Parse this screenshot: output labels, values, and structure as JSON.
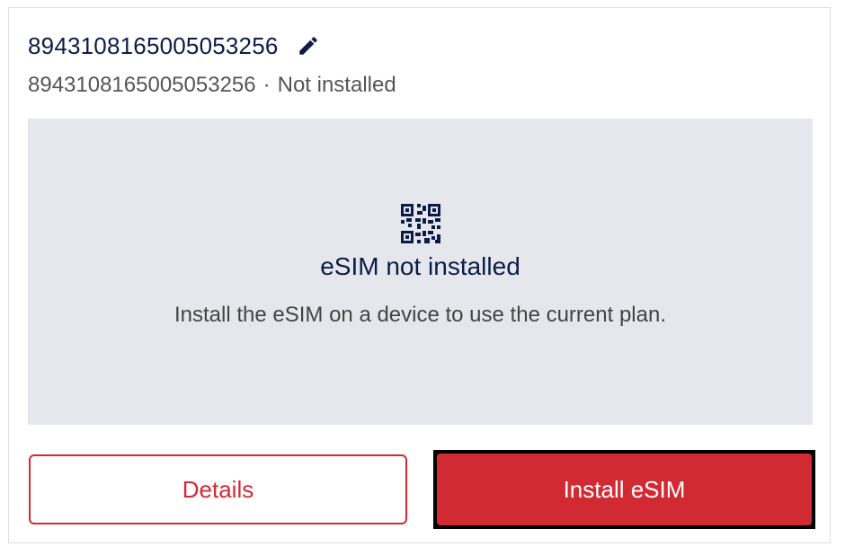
{
  "sim": {
    "name": "8943108165005053256",
    "iccid": "8943108165005053256",
    "separator": "·",
    "status": "Not installed"
  },
  "panel": {
    "icon": "qr-code-icon",
    "title": "eSIM not installed",
    "description": "Install the eSIM on a device to use the current plan."
  },
  "actions": {
    "details_label": "Details",
    "install_label": "Install eSIM"
  },
  "colors": {
    "navy": "#0d1b48",
    "accent_red": "#d12a33",
    "panel_bg": "#e6e7ec",
    "muted_text": "#555555"
  }
}
